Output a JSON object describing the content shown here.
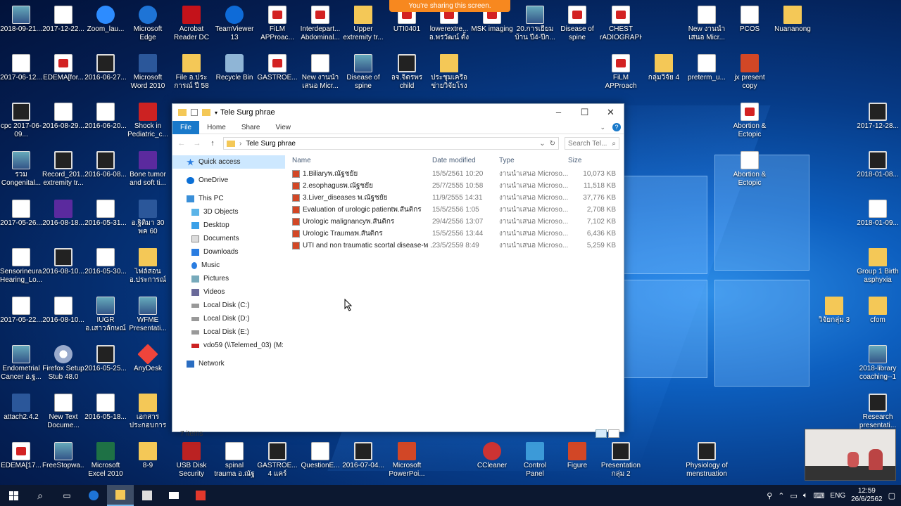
{
  "banner": {
    "sharing_text": "You're sharing this screen."
  },
  "desktop_icons": [
    {
      "label": "2018-09-21...",
      "kind": "img"
    },
    {
      "label": "2017-12-22...",
      "kind": "file"
    },
    {
      "label": "Zoom_lau...",
      "kind": "zoom"
    },
    {
      "label": "Microsoft Edge",
      "kind": "edge"
    },
    {
      "label": "Acrobat Reader DC",
      "kind": "acro"
    },
    {
      "label": "TeamViewer 13",
      "kind": "tv"
    },
    {
      "label": "FiLM APProac...",
      "kind": "pdf"
    },
    {
      "label": "Interdepart... Abdominal...",
      "kind": "pdf"
    },
    {
      "label": "Upper extremity tr...",
      "kind": "folder"
    },
    {
      "label": "UTI0401",
      "kind": "pdf"
    },
    {
      "label": "lowerextre... อ.พรวัฒน์ ตั้งสุ...",
      "kind": "pdf"
    },
    {
      "label": "MSK imaging",
      "kind": "pdf"
    },
    {
      "label": "20.การเยี่ยมบ้าน ปี4-ปีก...",
      "kind": "img"
    },
    {
      "label": "Disease of spine นพ.ณ...",
      "kind": "pdf"
    },
    {
      "label": "CHEST rADIOGRAPH",
      "kind": "pdf"
    },
    {
      "label": "New งานนำเสนอ Micr...",
      "kind": "file"
    },
    {
      "label": "PCOS",
      "kind": "file"
    },
    {
      "label": "Nuananong",
      "kind": "folder"
    },
    {
      "label": "2017-06-12...",
      "kind": "file"
    },
    {
      "label": "EDEMA[for...",
      "kind": "pdf"
    },
    {
      "label": "2016-06-27...",
      "kind": "video"
    },
    {
      "label": "Microsoft Word 2010",
      "kind": "word"
    },
    {
      "label": "File อ.ประการณ์ ปี 58",
      "kind": "folder"
    },
    {
      "label": "Recycle Bin",
      "kind": "bin"
    },
    {
      "label": "GASTROE...",
      "kind": "pdf"
    },
    {
      "label": "New งานนำเสนอ Micr...",
      "kind": "file"
    },
    {
      "label": "Disease of spine นพ.ณ...",
      "kind": "img"
    },
    {
      "label": "อจ.จิตรพร child maltreatme...",
      "kind": "video"
    },
    {
      "label": "ประชุมเครือข่ายวิจัยโรง พยาบ...",
      "kind": "folder"
    },
    {
      "label": "FiLM APProach",
      "kind": "pdf"
    },
    {
      "label": "กลุ่มวิจัย 4",
      "kind": "folder"
    },
    {
      "label": "preterm_u...",
      "kind": "file"
    },
    {
      "label": "jx present copy",
      "kind": "ppt"
    },
    {
      "label": "cpc 2017-06-09...",
      "kind": "video"
    },
    {
      "label": "2016-08-29...",
      "kind": "file"
    },
    {
      "label": "2016-06-20...",
      "kind": "file"
    },
    {
      "label": "Shock in Pediatric_c...",
      "kind": "shock"
    },
    {
      "label": "Abortion & Ectopic การ...",
      "kind": "pdf"
    },
    {
      "label": "2017-12-28...",
      "kind": "video"
    },
    {
      "label": "รวม Congenital...",
      "kind": "img"
    },
    {
      "label": "Record_201... extremity tr...",
      "kind": "video"
    },
    {
      "label": "2016-06-08...",
      "kind": "video"
    },
    {
      "label": "Bone tumor and soft ti...",
      "kind": "purple"
    },
    {
      "label": "Abortion & Ectopic การ...",
      "kind": "file"
    },
    {
      "label": "2018-01-08...",
      "kind": "video"
    },
    {
      "label": "2017-05-26...",
      "kind": "file"
    },
    {
      "label": "2016-08-18...",
      "kind": "purple"
    },
    {
      "label": "2016-05-31...",
      "kind": "file"
    },
    {
      "label": "อ.ฐิติมา 30 พค 60",
      "kind": "word"
    },
    {
      "label": "2018-01-09...",
      "kind": "file"
    },
    {
      "label": "Sensorineural Hearing_Lo...",
      "kind": "file"
    },
    {
      "label": "2016-08-10...",
      "kind": "video"
    },
    {
      "label": "2016-05-30...",
      "kind": "file"
    },
    {
      "label": "ไฟล์สอน อ.ประการณ์ 2559",
      "kind": "folder"
    },
    {
      "label": "Group 1 Birth asphyxia",
      "kind": "folder"
    },
    {
      "label": "2017-05-22...",
      "kind": "file"
    },
    {
      "label": "2016-08-10...",
      "kind": "file"
    },
    {
      "label": "IUGR อ.เสาวลักษณ์",
      "kind": "img"
    },
    {
      "label": "WFME Presentati...",
      "kind": "img"
    },
    {
      "label": "วิจัยกลุ่ม 3",
      "kind": "folder"
    },
    {
      "label": "cfom",
      "kind": "folder"
    },
    {
      "label": "Endometrial Cancer อ.ฐ...",
      "kind": "img"
    },
    {
      "label": "Firefox Setup Stub 48.0",
      "kind": "ff"
    },
    {
      "label": "2016-05-25...",
      "kind": "video"
    },
    {
      "label": "AnyDesk",
      "kind": "any"
    },
    {
      "label": "2018-library coaching--1",
      "kind": "img"
    },
    {
      "label": "attach2.4.2",
      "kind": "word"
    },
    {
      "label": "New Text Docume...",
      "kind": "text"
    },
    {
      "label": "2016-05-18...",
      "kind": "file"
    },
    {
      "label": "เอกสารประกอบการสอน อ.ฐ...",
      "kind": "folder"
    },
    {
      "label": "Research presentati...",
      "kind": "video"
    },
    {
      "label": "EDEMA[17...",
      "kind": "pdf"
    },
    {
      "label": "FreeStopwa...",
      "kind": "img"
    },
    {
      "label": "Microsoft Excel 2010",
      "kind": "excel"
    },
    {
      "label": "8-9",
      "kind": "folder"
    },
    {
      "label": "USB Disk Security",
      "kind": "usb"
    },
    {
      "label": "spinal trauma อ.ณัฐพร นม่า...",
      "kind": "file"
    },
    {
      "label": "GASTROE... 4 แคร์",
      "kind": "video"
    },
    {
      "label": "QuestionE...",
      "kind": "file"
    },
    {
      "label": "2016-07-04...",
      "kind": "video"
    },
    {
      "label": "Microsoft PowerPoi...",
      "kind": "ppt"
    },
    {
      "label": "CCleaner",
      "kind": "cc"
    },
    {
      "label": "Control Panel",
      "kind": "cp"
    },
    {
      "label": "Figure",
      "kind": "ppt"
    },
    {
      "label": "Presentation กลุ่ม 2",
      "kind": "video"
    },
    {
      "label": "Physiology of menstruation",
      "kind": "video"
    }
  ],
  "explorer": {
    "title": "Tele Surg phrae",
    "tabs": {
      "file": "File",
      "home": "Home",
      "share": "Share",
      "view": "View"
    },
    "address": "Tele Surg phrae",
    "search_placeholder": "Search Tel...",
    "nav": {
      "quick_access": "Quick access",
      "onedrive": "OneDrive",
      "this_pc": "This PC",
      "objects": "3D Objects",
      "desktop": "Desktop",
      "documents": "Documents",
      "downloads": "Downloads",
      "music": "Music",
      "pictures": "Pictures",
      "videos": "Videos",
      "disk_c": "Local Disk (C:)",
      "disk_d": "Local Disk (D:)",
      "disk_e": "Local Disk (E:)",
      "net_drive": "vdo59 (\\\\Telemed_03) (M:",
      "network": "Network"
    },
    "columns": {
      "name": "Name",
      "date": "Date modified",
      "type": "Type",
      "size": "Size"
    },
    "files": [
      {
        "name": "1.Biliaryพ.ณัฐชยัย",
        "date": "15/5/2561 10:20",
        "type": "งานนำเสนอ Microso...",
        "size": "10,073 KB"
      },
      {
        "name": "2.esophagusพ.ณัฐชยัย",
        "date": "25/7/2555 10:58",
        "type": "งานนำเสนอ Microso...",
        "size": "11,518 KB"
      },
      {
        "name": "3.Liver_diseases พ.ณัฐชยัย",
        "date": "11/9/2555 14:31",
        "type": "งานนำเสนอ Microso...",
        "size": "37,776 KB"
      },
      {
        "name": "Evaluation of urologic patientพ.สันติกร",
        "date": "15/5/2556 1:05",
        "type": "งานนำเสนอ Microso...",
        "size": "2,708 KB"
      },
      {
        "name": "Urologic malignancyพ.สันติกร",
        "date": "29/4/2556 13:07",
        "type": "งานนำเสนอ Microso...",
        "size": "7,102 KB"
      },
      {
        "name": "Urologic Traumaพ.สันติกร",
        "date": "15/5/2556 13:44",
        "type": "งานนำเสนอ Microso...",
        "size": "6,436 KB"
      },
      {
        "name": "UTI and non traumatic scortal disease-พ ...",
        "date": "23/5/2559 8:49",
        "type": "งานนำเสนอ Microso...",
        "size": "5,259 KB"
      }
    ],
    "status": "7 items"
  },
  "taskbar": {
    "lang": "ENG",
    "time": "12:59",
    "date": "26/6/2562"
  }
}
